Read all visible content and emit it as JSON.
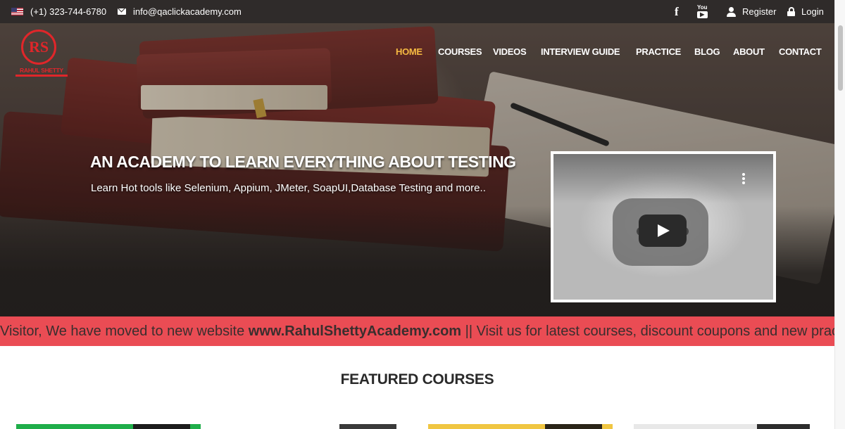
{
  "topbar": {
    "phone": "(+1) 323-744-6780",
    "email": "info@qaclickacademy.com",
    "register": "Register",
    "login": "Login",
    "youtube_icon_text": "You"
  },
  "logo": {
    "initials": "RS",
    "name": "RAHUL SHETTY"
  },
  "nav": {
    "items": [
      "HOME",
      "COURSES",
      "VIDEOS",
      "INTERVIEW GUIDE",
      "PRACTICE",
      "BLOG",
      "ABOUT",
      "CONTACT"
    ],
    "active": "HOME"
  },
  "hero": {
    "title": "AN ACADEMY TO LEARN EVERYTHING ABOUT TESTING",
    "subtitle": "Learn Hot tools like Selenium, Appium, JMeter, SoapUI,Database Testing and more.."
  },
  "marquee": {
    "prefix": "Visitor, We have moved to new website ",
    "link": "www.RahulShettyAcademy.com",
    "suffix": " || Visit us for latest courses, discount coupons and new practice"
  },
  "featured": {
    "title": "FEATURED COURSES"
  },
  "colors": {
    "topbar_bg": "#2f2b2a",
    "nav_active": "#f5b942",
    "marquee_bg": "#ea4c54",
    "brand_red": "#e0262a"
  },
  "icons": {
    "flag": "us-flag-icon",
    "mail": "mail-icon",
    "facebook": "facebook-icon",
    "youtube": "youtube-icon",
    "user": "user-icon",
    "lock": "lock-icon"
  }
}
